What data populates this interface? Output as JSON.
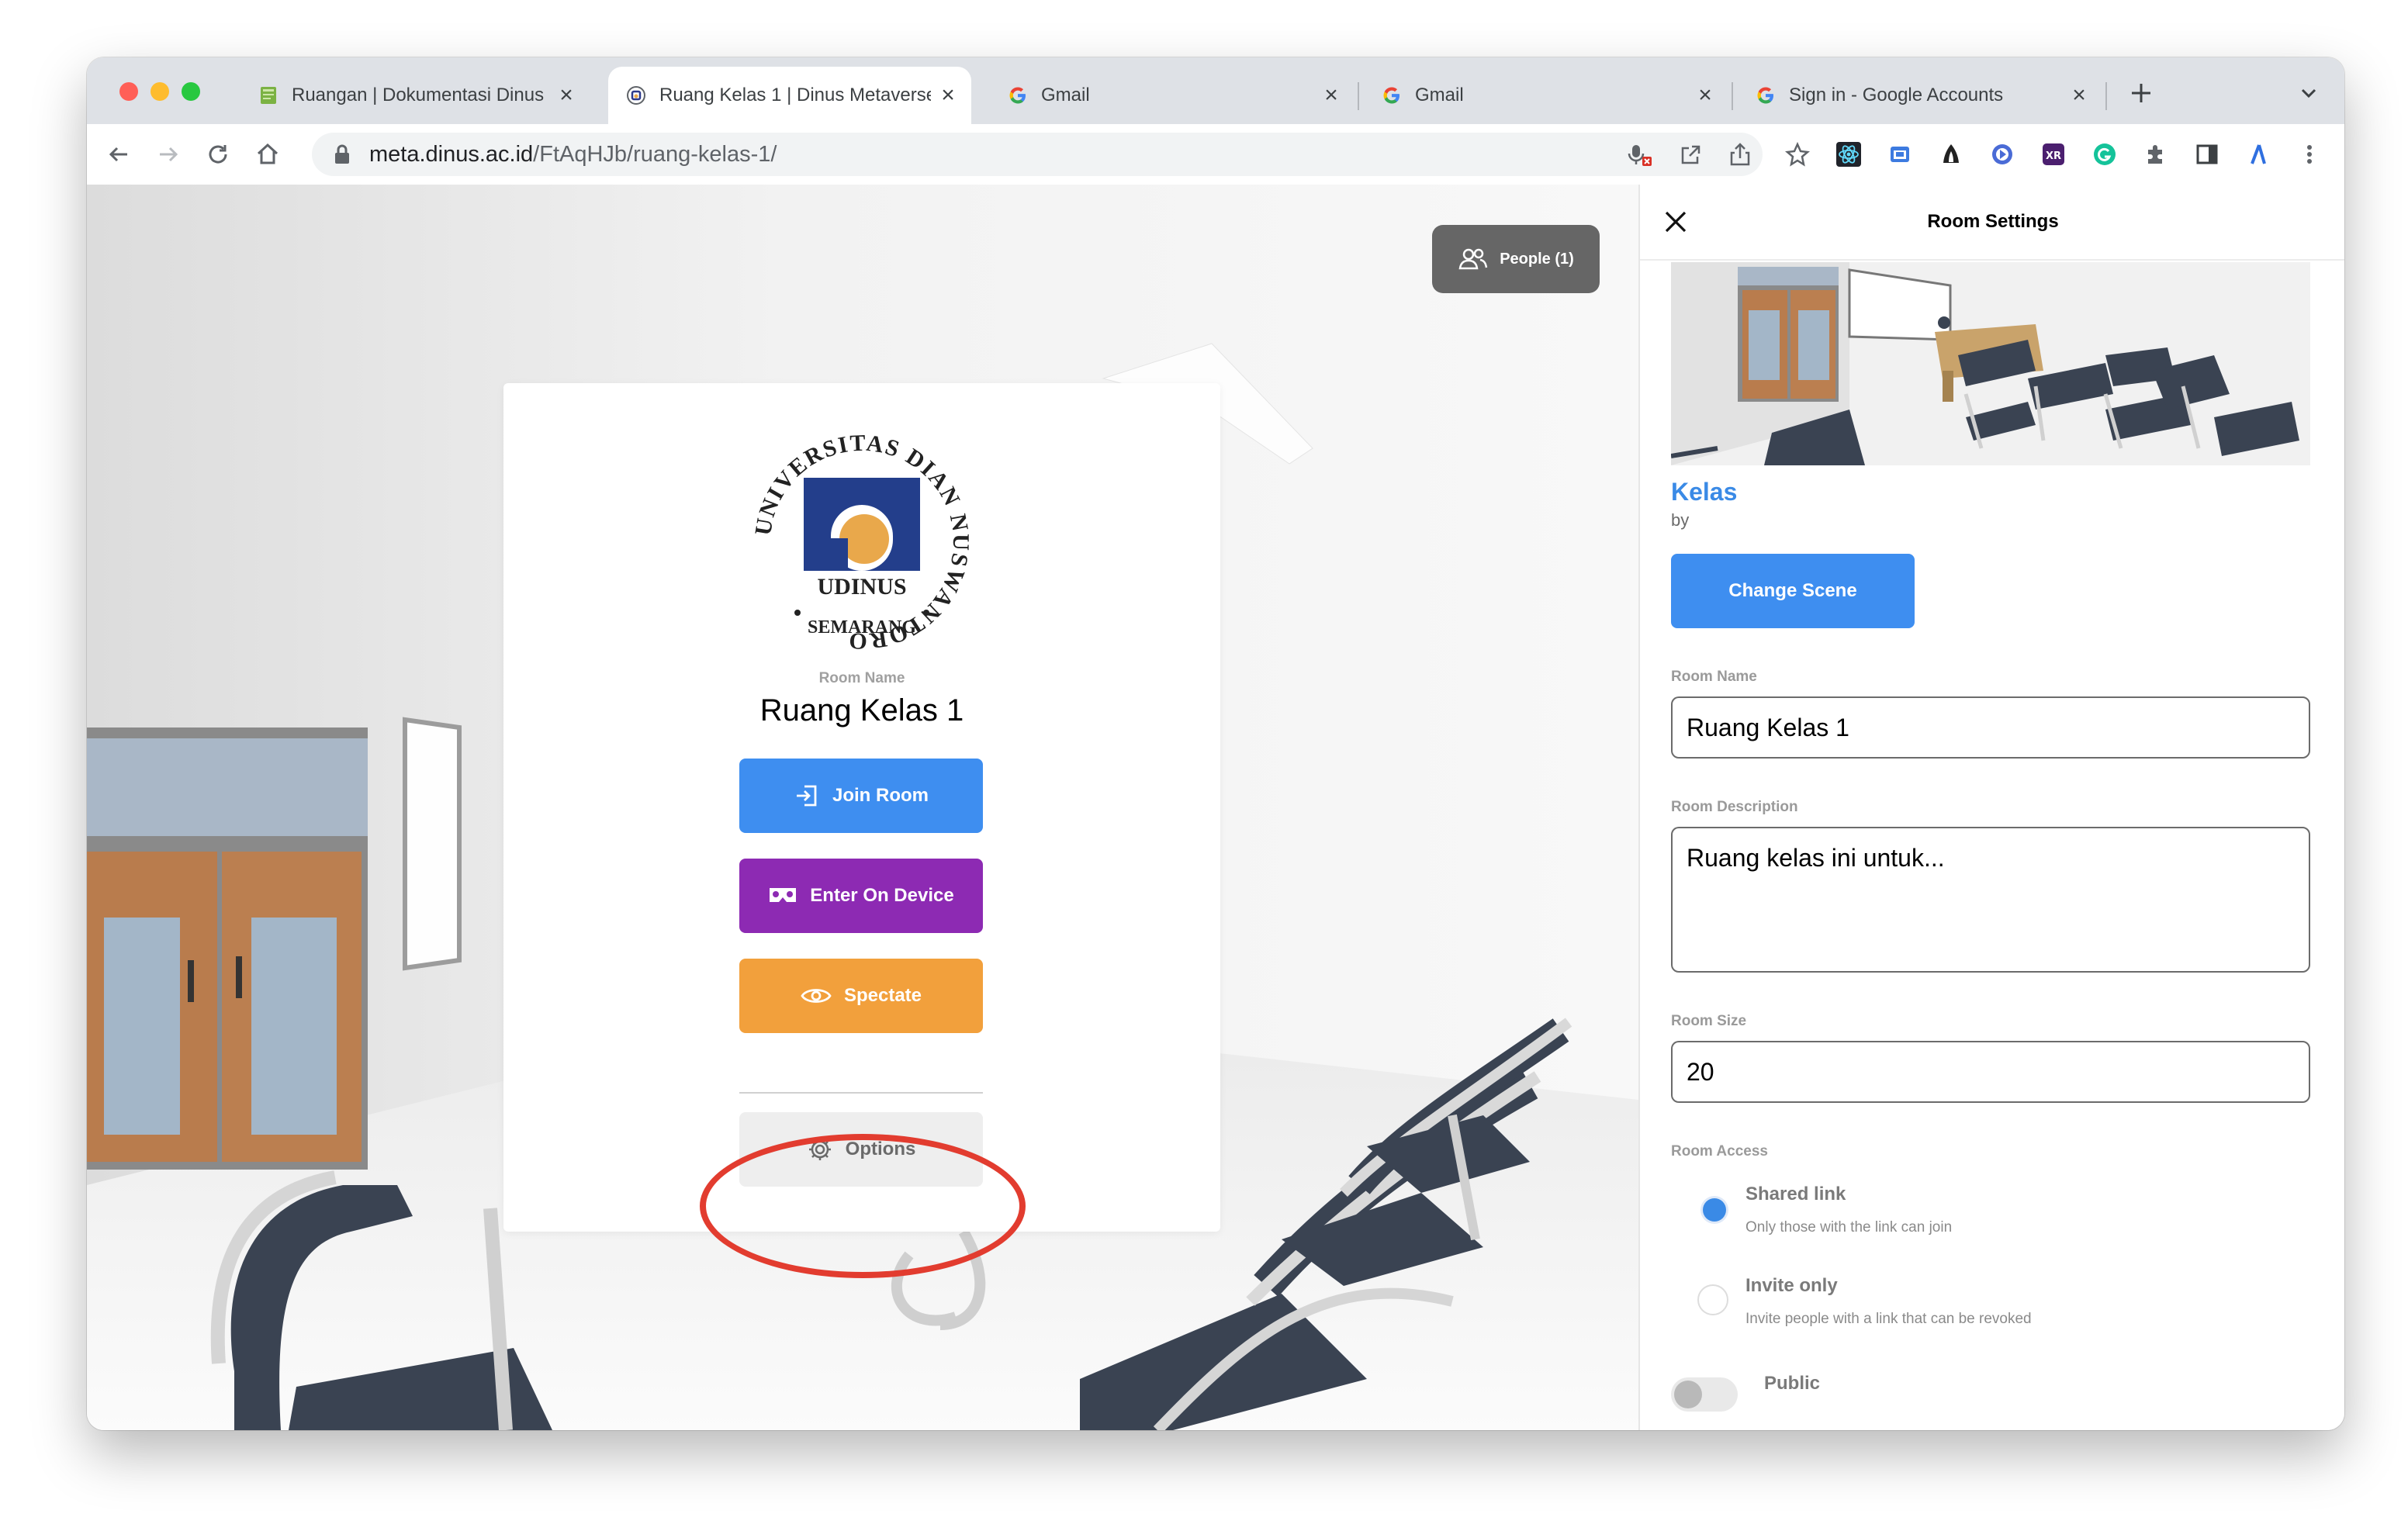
{
  "browser": {
    "tabs": [
      {
        "title": "Ruangan | Dokumentasi Dinus M",
        "favicon": "docs-book-icon",
        "active": false
      },
      {
        "title": "Ruang Kelas 1 | Dinus Metaverse",
        "favicon": "hubs-icon",
        "active": true
      },
      {
        "title": "Gmail",
        "favicon": "google-g-icon",
        "active": false
      },
      {
        "title": "Gmail",
        "favicon": "google-g-icon",
        "active": false
      },
      {
        "title": "Sign in - Google Accounts",
        "favicon": "google-g-icon",
        "active": false
      }
    ],
    "url_host": "meta.dinus.ac.id",
    "url_path": "/FtAqHJb/ruang-kelas-1/"
  },
  "header": {
    "people_label": "People (1)"
  },
  "entry": {
    "logo": {
      "ring_text": "UNIVERSITAS DIAN NUSWANTORO",
      "center_text": "UDINUS",
      "bottom_text": "SEMARANG"
    },
    "room_name_label": "Room Name",
    "room_name": "Ruang Kelas 1",
    "join_label": "Join Room",
    "enter_device_label": "Enter On Device",
    "spectate_label": "Spectate",
    "options_label": "Options",
    "colors": {
      "join": "#3e8ef0",
      "enter": "#8d2ab3",
      "spectate": "#f2a03c",
      "options_bg": "#eeeeee",
      "highlight_circle": "#e23c2f"
    }
  },
  "settings": {
    "title": "Room Settings",
    "scene_name": "Kelas",
    "scene_by": "by",
    "change_scene_label": "Change Scene",
    "room_name_label": "Room Name",
    "room_name_value": "Ruang Kelas 1",
    "room_description_label": "Room Description",
    "room_description_value": "Ruang kelas ini untuk...",
    "room_size_label": "Room Size",
    "room_size_value": "20",
    "room_access_label": "Room Access",
    "access_options": [
      {
        "title": "Shared link",
        "desc": "Only those with the link can join",
        "selected": true
      },
      {
        "title": "Invite only",
        "desc": "Invite people with a link that can be revoked",
        "selected": false
      }
    ],
    "public_label": "Public",
    "colors": {
      "accent": "#3a8ae6"
    }
  }
}
